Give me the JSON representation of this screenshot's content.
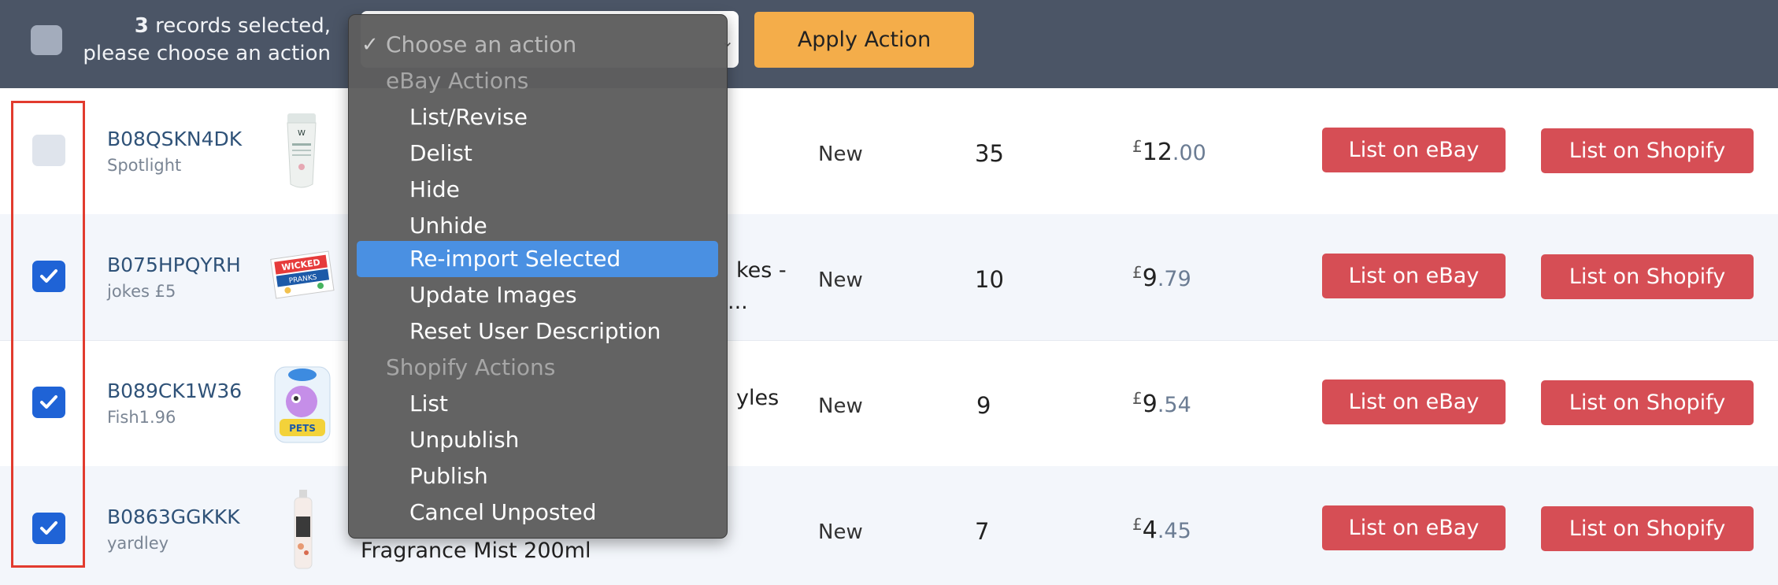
{
  "header": {
    "selected_count": "3",
    "selected_text_line1": " records selected,",
    "selected_text_line2": "please choose an action",
    "apply_label": "Apply Action"
  },
  "dropdown": {
    "placeholder": "Choose an action",
    "selected_mark": "✓",
    "groups": [
      {
        "label": "eBay Actions",
        "items": [
          "List/Revise",
          "Delist",
          "Hide",
          "Unhide",
          "Re-import Selected",
          "Update Images",
          "Reset User Description"
        ]
      },
      {
        "label": "Shopify Actions",
        "items": [
          "List",
          "Unpublish",
          "Publish",
          "Cancel Unposted"
        ]
      }
    ],
    "highlighted_item": "Re-import Selected"
  },
  "rows": [
    {
      "checked": false,
      "sku": "B08QSKN4DK",
      "sub": "Spotlight",
      "title_line1": "",
      "title_line2": "",
      "condition": "New",
      "qty": "35",
      "currency": "£",
      "price_int": "12",
      "price_dec": ".00",
      "ebay_label": "List on eBay",
      "shopify_label": "List on Shopify"
    },
    {
      "checked": true,
      "sku": "B075HPQYRH",
      "sub": "jokes £5",
      "title_line1": "kes -",
      "title_line2": "...",
      "condition": "New",
      "qty": "10",
      "currency": "£",
      "price_int": "9",
      "price_dec": ".79",
      "ebay_label": "List on eBay",
      "shopify_label": "List on Shopify"
    },
    {
      "checked": true,
      "sku": "B089CK1W36",
      "sub": "Fish1.96",
      "title_line1": "yles",
      "title_line2": "",
      "condition": "New",
      "qty": "9",
      "currency": "£",
      "price_int": "9",
      "price_dec": ".54",
      "ebay_label": "List on eBay",
      "shopify_label": "List on Shopify"
    },
    {
      "checked": true,
      "sku": "B0863GGKKK",
      "sub": "yardley",
      "title_line1": "",
      "title_line2": "Fragrance Mist 200ml",
      "condition": "New",
      "qty": "7",
      "currency": "£",
      "price_int": "4",
      "price_dec": ".45",
      "ebay_label": "List on eBay",
      "shopify_label": "List on Shopify"
    }
  ],
  "colors": {
    "topbar": "#4b5566",
    "apply_button": "#f4ad4a",
    "list_buttons": "#d64e55",
    "checkbox_checked": "#1f63d6",
    "menu_highlight": "#4a90e2",
    "annotation_box": "#e23b2e"
  }
}
